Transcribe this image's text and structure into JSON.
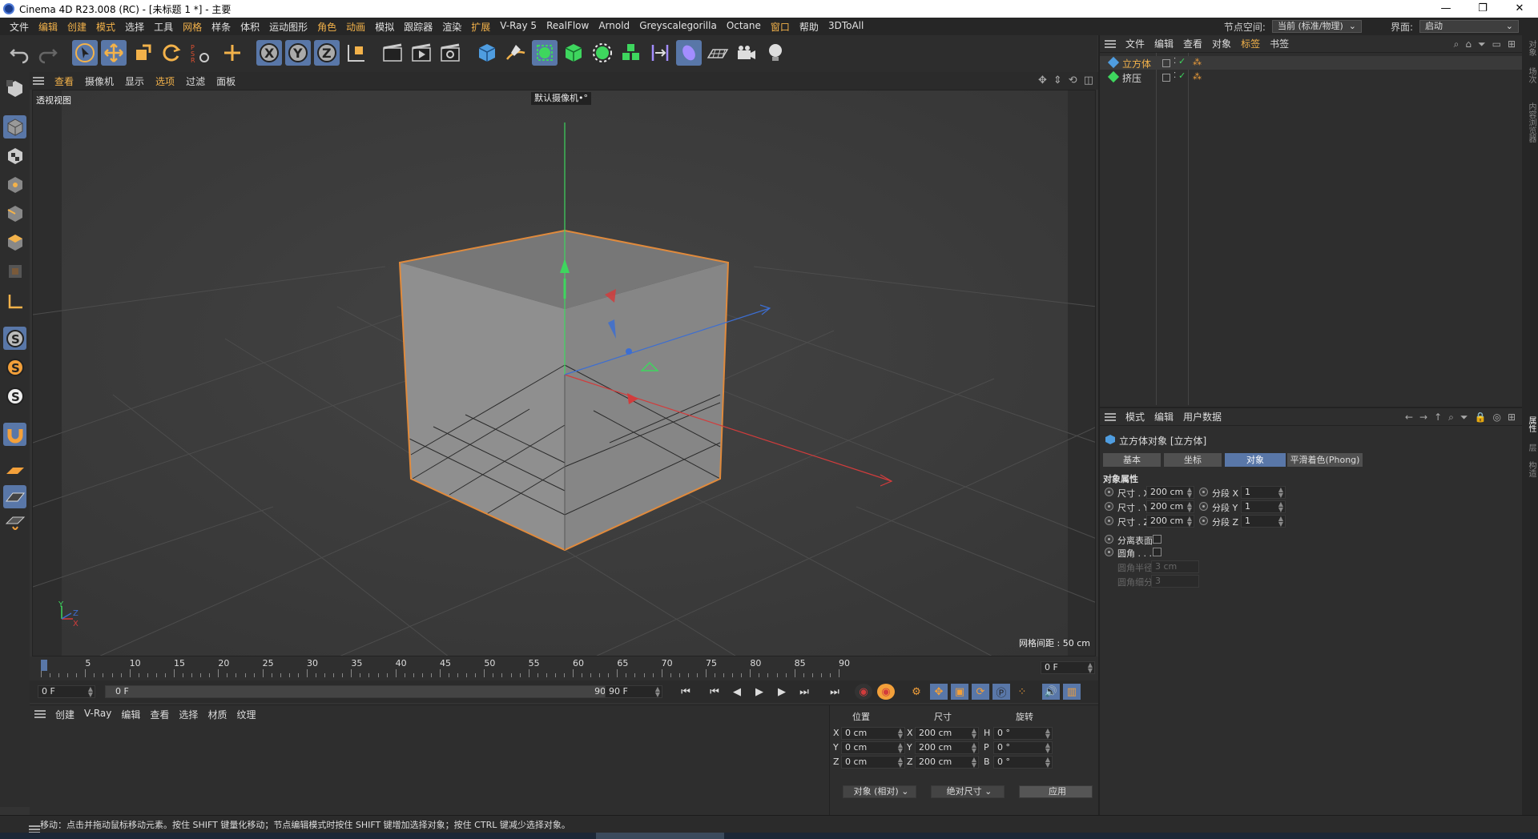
{
  "window": {
    "title": "Cinema 4D R23.008 (RC) - [未标题 1 *] - 主要",
    "min": "—",
    "restore": "❐",
    "close": "✕"
  },
  "menu": {
    "items": [
      "文件",
      "编辑",
      "创建",
      "模式",
      "选择",
      "工具",
      "网格",
      "样条",
      "体积",
      "运动图形",
      "角色",
      "动画",
      "模拟",
      "跟踪器",
      "渲染",
      "扩展",
      "V-Ray 5",
      "RealFlow",
      "Arnold",
      "Greyscalegorilla",
      "Octane",
      "窗口",
      "帮助",
      "3DToAll"
    ],
    "highlighted": [
      "编辑",
      "创建",
      "模式",
      "网格",
      "角色",
      "动画",
      "扩展",
      "窗口"
    ],
    "node_space_label": "节点空间:",
    "node_space_value": "当前 (标准/物理)",
    "layout_label": "界面:",
    "layout_value": "启动"
  },
  "viewport_menu": {
    "items": [
      "查看",
      "摄像机",
      "显示",
      "选项",
      "过滤",
      "面板"
    ],
    "highlighted": [
      "查看",
      "选项"
    ]
  },
  "viewport": {
    "view_name": "透视视图",
    "camera_name": "默认摄像机",
    "camera_icon": "•°",
    "grid_spacing": "网格间距 : 50 cm",
    "axis_y": "Y",
    "axis_z": "Z",
    "axis_x": "X"
  },
  "timeline": {
    "ticks": [
      "0",
      "5",
      "10",
      "15",
      "20",
      "25",
      "30",
      "35",
      "40",
      "45",
      "50",
      "55",
      "60",
      "65",
      "70",
      "75",
      "80",
      "85",
      "90"
    ],
    "current_frame_field": "0 F"
  },
  "playbar": {
    "start_field": "0 F",
    "range_start": "0 F",
    "range_end": "90 F",
    "end_field": "90 F"
  },
  "material_manager": {
    "menu": [
      "创建",
      "V-Ray",
      "编辑",
      "查看",
      "选择",
      "材质",
      "纹理"
    ]
  },
  "coordinates": {
    "headers": {
      "position": "位置",
      "size": "尺寸",
      "rotation": "旋转"
    },
    "rows": [
      {
        "axis": "X",
        "pos": "0 cm",
        "size_axis": "X",
        "size": "200 cm",
        "rot_axis": "H",
        "rot": "0 °"
      },
      {
        "axis": "Y",
        "pos": "0 cm",
        "size_axis": "Y",
        "size": "200 cm",
        "rot_axis": "P",
        "rot": "0 °"
      },
      {
        "axis": "Z",
        "pos": "0 cm",
        "size_axis": "Z",
        "size": "200 cm",
        "rot_axis": "B",
        "rot": "0 °"
      }
    ],
    "mode_dropdown": "对象 (相对)",
    "size_dropdown": "绝对尺寸",
    "apply": "应用"
  },
  "object_manager": {
    "menu": [
      "文件",
      "编辑",
      "查看",
      "对象",
      "标签",
      "书签"
    ],
    "highlighted": [
      "标签"
    ],
    "objects": [
      {
        "name": "立方体",
        "color": "#f3b24a"
      },
      {
        "name": "挤压",
        "color": "#dddddd"
      }
    ]
  },
  "attribute_manager": {
    "menu": [
      "模式",
      "编辑",
      "用户数据"
    ],
    "title": "立方体对象 [立方体]",
    "tabs": [
      "基本",
      "坐标",
      "对象",
      "平滑着色(Phong)"
    ],
    "active_tab": "对象",
    "section": "对象属性",
    "size_rows": [
      {
        "label": "尺寸 . X",
        "value": "200 cm",
        "seg_label": "分段 X",
        "seg": "1"
      },
      {
        "label": "尺寸 . Y",
        "value": "200 cm",
        "seg_label": "分段 Y",
        "seg": "1"
      },
      {
        "label": "尺寸 . Z",
        "value": "200 cm",
        "seg_label": "分段 Z",
        "seg": "1"
      }
    ],
    "separate_surfaces": "分离表面",
    "fillet": "圆角 . . . .",
    "fillet_radius_label": "圆角半径",
    "fillet_radius": "3 cm",
    "fillet_subdiv_label": "圆角细分",
    "fillet_subdiv": "3"
  },
  "right_rail": {
    "tabs": [
      "对象",
      "场次",
      "内容浏览器",
      "属性",
      "层",
      "构造"
    ]
  },
  "status": {
    "text": "移动：点击并拖动鼠标移动元素。按住 SHIFT 键量化移动；节点编辑模式时按住 SHIFT 键增加选择对象；按住 CTRL 键减少选择对象。"
  },
  "colors": {
    "accent_orange": "#f3b24a",
    "active_blue": "#5977a8",
    "selection_outline": "#e08a3c"
  }
}
